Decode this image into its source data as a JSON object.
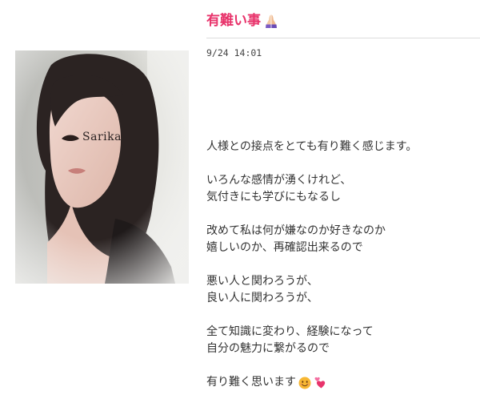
{
  "post": {
    "title": "有難い事",
    "title_emoji_icon": "praying-hands-icon",
    "timestamp": "9/24 14:01",
    "photo_caption": "Sarika",
    "paragraphs": [
      {
        "lines": [
          "人様との接点をとても有り難く感じます。"
        ]
      },
      {
        "lines": [
          "いろんな感情が湧くけれど、",
          "気付きにも学びにもなるし"
        ]
      },
      {
        "lines": [
          "改めて私は何が嫌なのか好きなのか",
          "嬉しいのか、再確認出来るので"
        ]
      },
      {
        "lines": [
          "悪い人と関わろうが、",
          "良い人に関わろうが、"
        ]
      },
      {
        "lines": [
          "全て知識に変わり、経験になって",
          "自分の魅力に繋がるので"
        ]
      }
    ],
    "closing_line": "有り難く思います",
    "closing_emoji_icons": [
      "smiling-face-icon",
      "two-hearts-icon"
    ]
  },
  "colors": {
    "title": "#e8336b",
    "text": "#333333",
    "timestamp": "#444444",
    "divider": "#dcdcdc",
    "background": "#ffffff"
  }
}
